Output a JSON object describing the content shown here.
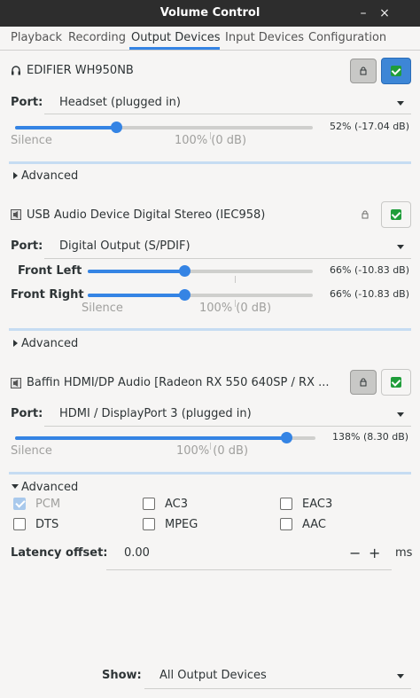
{
  "window": {
    "title": "Volume Control",
    "minimize": "–",
    "close": "×"
  },
  "tabs": [
    {
      "label": "Playback"
    },
    {
      "label": "Recording"
    },
    {
      "label": "Output Devices",
      "active": true
    },
    {
      "label": "Input Devices"
    },
    {
      "label": "Configuration"
    }
  ],
  "devices": [
    {
      "name": "EDIFIER WH950NB",
      "icon": "headset-icon",
      "locked": true,
      "muted_button_active": true,
      "port_label": "Port:",
      "port_value": "Headset (plugged in)",
      "channels": [
        {
          "label": "",
          "percent": 52,
          "readout": "52% (-17.04 dB)"
        }
      ],
      "scale": {
        "silence": "Silence",
        "hundred": "100% (0 dB)"
      },
      "advanced_label": "Advanced",
      "advanced_expanded": false
    },
    {
      "name": "USB Audio Device Digital Stereo (IEC958)",
      "icon": "speaker-icon",
      "locked": false,
      "muted_button_active": false,
      "port_label": "Port:",
      "port_value": "Digital Output (S/PDIF)",
      "channels": [
        {
          "label": "Front Left",
          "percent": 66,
          "readout": "66% (-10.83 dB)"
        },
        {
          "label": "Front Right",
          "percent": 66,
          "readout": "66% (-10.83 dB)"
        }
      ],
      "scale": {
        "silence": "Silence",
        "hundred": "100% (0 dB)"
      },
      "advanced_label": "Advanced",
      "advanced_expanded": false
    },
    {
      "name": "Baffin HDMI/DP Audio [Radeon RX 550 640SP / RX ...",
      "icon": "speaker-icon",
      "locked": true,
      "muted_button_active": false,
      "port_label": "Port:",
      "port_value": "HDMI / DisplayPort 3 (plugged in)",
      "channels": [
        {
          "label": "",
          "percent": 138,
          "readout": "138% (8.30 dB)"
        }
      ],
      "scale": {
        "silence": "Silence",
        "hundred": "100% (0 dB)"
      },
      "advanced_label": "Advanced",
      "advanced_expanded": true,
      "formats": [
        {
          "label": "PCM",
          "checked": true,
          "disabled": true
        },
        {
          "label": "AC3",
          "checked": false
        },
        {
          "label": "EAC3",
          "checked": false
        },
        {
          "label": "DTS",
          "checked": false
        },
        {
          "label": "MPEG",
          "checked": false
        },
        {
          "label": "AAC",
          "checked": false
        }
      ],
      "latency": {
        "label": "Latency offset:",
        "value": "0.00",
        "minus": "−",
        "plus": "+",
        "unit": "ms"
      }
    }
  ],
  "footer": {
    "show_label": "Show:",
    "show_value": "All Output Devices"
  },
  "colors": {
    "accent": "#3584e4",
    "titlebar": "#2d2d2d",
    "mute_green": "#1f9d3a"
  }
}
